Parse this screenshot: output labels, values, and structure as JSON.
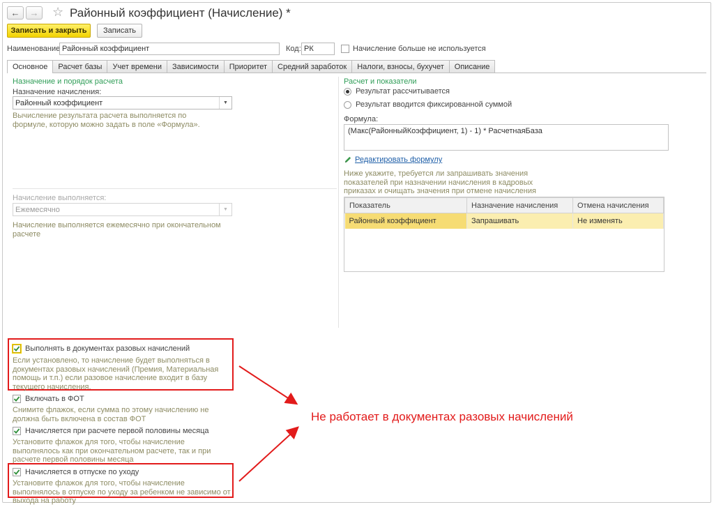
{
  "window": {
    "title": "Районный коэффициент (Начисление) *"
  },
  "toolbar": {
    "save_close_label": "Записать и закрыть",
    "save_label": "Записать"
  },
  "header": {
    "name_label": "Наименование:",
    "name_value": "Районный коэффициент",
    "code_label": "Код:",
    "code_value": "РК",
    "unused_label": "Начисление больше не используется",
    "unused_checked": false
  },
  "tabs": [
    {
      "label": "Основное",
      "active": true
    },
    {
      "label": "Расчет базы"
    },
    {
      "label": "Учет времени"
    },
    {
      "label": "Зависимости"
    },
    {
      "label": "Приоритет"
    },
    {
      "label": "Средний заработок"
    },
    {
      "label": "Налоги, взносы, бухучет"
    },
    {
      "label": "Описание"
    }
  ],
  "left": {
    "group_title": "Назначение и порядок расчета",
    "purpose_label": "Назначение начисления:",
    "purpose_value": "Районный коэффициент",
    "purpose_hint": "Вычисление результата расчета выполняется по формуле, которую можно задать в поле «Формула».",
    "period_label": "Начисление выполняется:",
    "period_value": "Ежемесячно",
    "period_hint": "Начисление выполняется ежемесячно при окончательном расчете"
  },
  "right": {
    "group_title": "Расчет и показатели",
    "radio_calculated": "Результат рассчитывается",
    "radio_fixed": "Результат вводится фиксированной суммой",
    "formula_label": "Формула:",
    "formula_value": "(Макс(РайонныйКоэффициент, 1) - 1) * РасчетнаяБаза",
    "edit_formula_link": "Редактировать формулу",
    "indicators_hint": "Ниже укажите, требуется ли запрашивать значения показателей при назначении начисления в кадровых приказах и очищать значения при отмене начисления",
    "table": {
      "columns": [
        "Показатель",
        "Назначение начисления",
        "Отмена начисления"
      ],
      "rows": [
        [
          "Районный коэффициент",
          "Запрашивать",
          "Не изменять"
        ]
      ]
    }
  },
  "options": {
    "one_time_docs": {
      "label": "Выполнять в документах разовых начислений",
      "checked": true,
      "hint": "Если установлено, то начисление будет выполняться в документах разовых начислений (Премия, Материальная помощь и т.п.) если разовое начисление входит в базу текущего начисления."
    },
    "fot": {
      "label": "Включать в ФОТ",
      "checked": true,
      "hint": "Снимите флажок, если сумма по этому начислению не должна быть включена в состав ФОТ"
    },
    "first_half": {
      "label": "Начисляется при расчете первой половины месяца",
      "checked": true,
      "hint": "Установите флажок для того, чтобы начисление выполнялось как при окончательном расчете, так и при расчете первой половины месяца"
    },
    "childcare_leave": {
      "label": "Начисляется в отпуске по уходу",
      "checked": true,
      "hint": "Установите флажок для того, чтобы начисление выполнялось в отпуске по уходу за ребенком не зависимо от выхода на работу"
    }
  },
  "annotation": {
    "text": "Не работает в документах разовых начислений",
    "color": "#e21b1b"
  },
  "colors": {
    "accent_yellow": "#f3d300",
    "group_title_green": "#2f9d57",
    "hint_olive": "#8d8b63",
    "link_blue": "#1f5fa8",
    "selected_row": "#fbeeb0"
  }
}
